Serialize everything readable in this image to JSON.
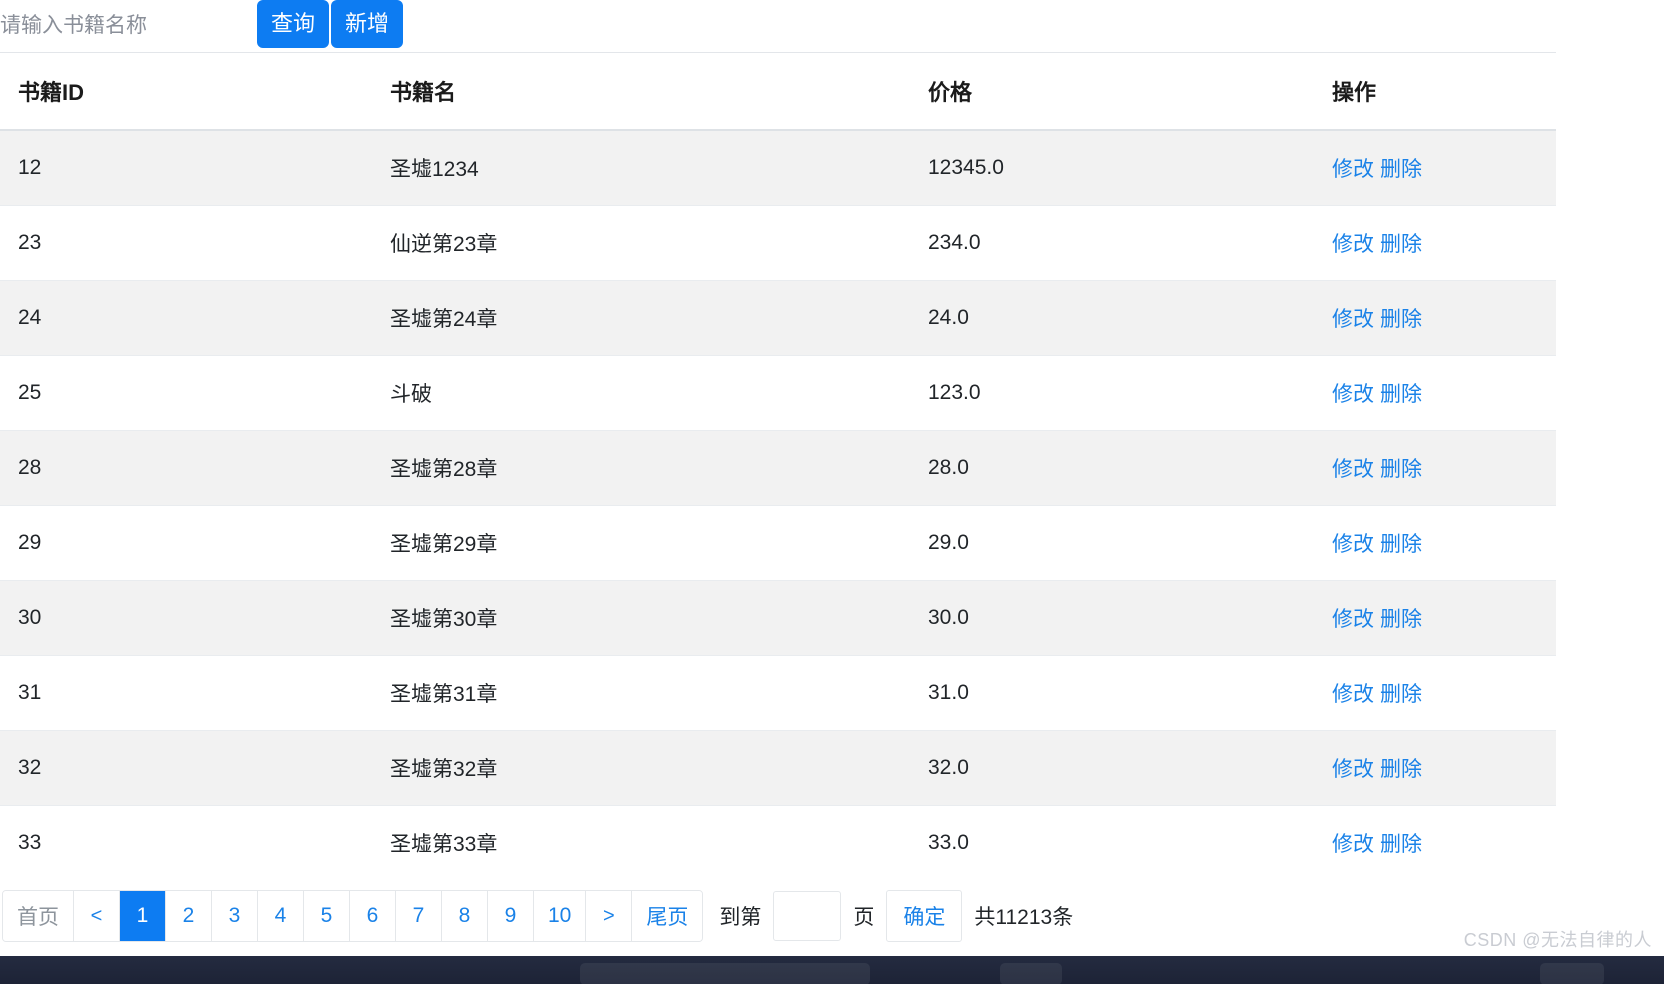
{
  "toolbar": {
    "search_placeholder": "请输入书籍名称",
    "search_value": "",
    "query_label": "查询",
    "add_label": "新增"
  },
  "table": {
    "columns": [
      "书籍ID",
      "书籍名",
      "价格",
      "操作"
    ],
    "action_edit": "修改",
    "action_delete": "删除",
    "rows": [
      {
        "id": "12",
        "name": "圣墟1234",
        "price": "12345.0"
      },
      {
        "id": "23",
        "name": "仙逆第23章",
        "price": "234.0"
      },
      {
        "id": "24",
        "name": "圣墟第24章",
        "price": "24.0"
      },
      {
        "id": "25",
        "name": "斗破",
        "price": "123.0"
      },
      {
        "id": "28",
        "name": "圣墟第28章",
        "price": "28.0"
      },
      {
        "id": "29",
        "name": "圣墟第29章",
        "price": "29.0"
      },
      {
        "id": "30",
        "name": "圣墟第30章",
        "price": "30.0"
      },
      {
        "id": "31",
        "name": "圣墟第31章",
        "price": "31.0"
      },
      {
        "id": "32",
        "name": "圣墟第32章",
        "price": "32.0"
      },
      {
        "id": "33",
        "name": "圣墟第33章",
        "price": "33.0"
      }
    ]
  },
  "pagination": {
    "first_label": "首页",
    "prev_label": "<",
    "next_label": ">",
    "last_label": "尾页",
    "pages": [
      "1",
      "2",
      "3",
      "4",
      "5",
      "6",
      "7",
      "8",
      "9",
      "10"
    ],
    "active_page": "1",
    "jump_prefix": "到第",
    "jump_value": "",
    "jump_suffix": "页",
    "confirm_label": "确定",
    "total_text": "共11213条"
  },
  "watermark": {
    "text": "CSDN @无法自律的人"
  },
  "colors": {
    "primary": "#0d7cf2",
    "link": "#1a82e8",
    "row_stripe": "#f2f2f2",
    "border": "#e4e7ea",
    "disabled": "#8d949c"
  }
}
